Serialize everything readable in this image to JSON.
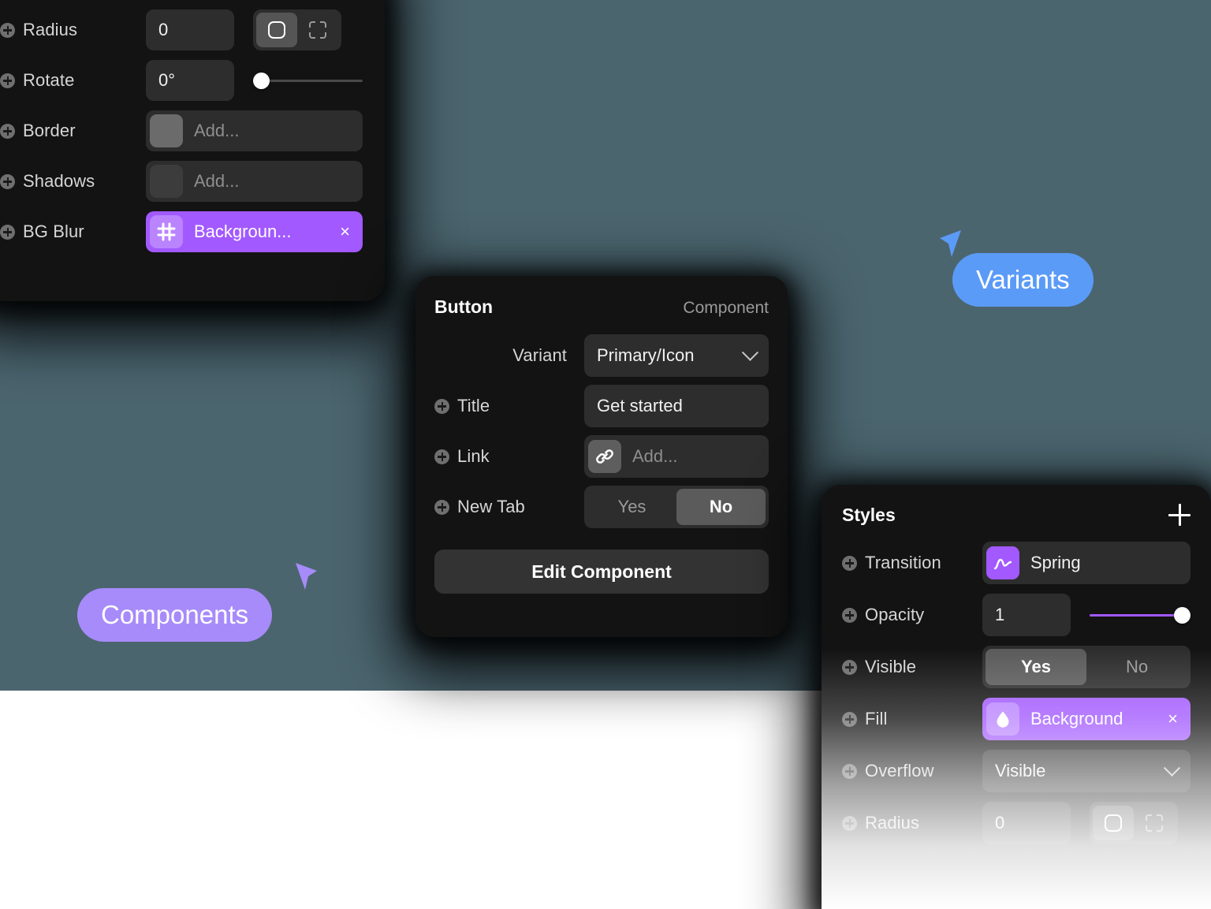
{
  "canvas": {
    "background_color": "#4b656f",
    "lower_band_color": "#ffffff"
  },
  "left_panel": {
    "rows": [
      {
        "label": "Radius",
        "type": "number-with-segmented",
        "value": "0",
        "segments": [
          {
            "icon": "rounded-square-icon",
            "selected": true
          },
          {
            "icon": "corner-brackets-icon",
            "selected": false
          }
        ]
      },
      {
        "label": "Rotate",
        "type": "number-with-slider",
        "value": "0°",
        "slider": {
          "percent": 0,
          "filled": false
        }
      },
      {
        "label": "Border",
        "type": "swatch-add",
        "placeholder": "Add...",
        "swatch_color": "#6b6b6b"
      },
      {
        "label": "Shadows",
        "type": "swatch-add",
        "placeholder": "Add...",
        "swatch_color": "#3c3c3c"
      },
      {
        "label": "BG Blur",
        "type": "chip",
        "chip_label": "Backgroun...",
        "chip_icon": "frame-hash-icon",
        "chip_color": "#a259ff",
        "removable": true,
        "remove_glyph": "×"
      }
    ]
  },
  "button_panel": {
    "title": "Button",
    "type_label": "Component",
    "rows": [
      {
        "label": "Variant",
        "has_plus": false,
        "control": "dropdown",
        "value": "Primary/Icon"
      },
      {
        "label": "Title",
        "has_plus": true,
        "control": "text",
        "value": "Get started"
      },
      {
        "label": "Link",
        "has_plus": true,
        "control": "icon-text",
        "icon": "link-chain-icon",
        "placeholder": "Add..."
      },
      {
        "label": "New Tab",
        "has_plus": true,
        "control": "toggle",
        "options": [
          "Yes",
          "No"
        ],
        "selected": "No"
      }
    ],
    "action_label": "Edit Component"
  },
  "styles_panel": {
    "title": "Styles",
    "add_icon": "plus-icon",
    "rows": [
      {
        "label": "Transition",
        "control": "icon-text",
        "icon": "spring-curve-icon",
        "value": "Spring",
        "icon_color": "#a259ff"
      },
      {
        "label": "Opacity",
        "control": "number-with-slider",
        "value": "1",
        "slider": {
          "percent": 100,
          "filled": true,
          "color": "#a259ff"
        }
      },
      {
        "label": "Visible",
        "control": "toggle",
        "options": [
          "Yes",
          "No"
        ],
        "selected": "Yes"
      },
      {
        "label": "Fill",
        "control": "chip",
        "chip_label": "Background",
        "chip_icon": "droplet-icon",
        "chip_color": "#a259ff",
        "removable": true,
        "remove_glyph": "×"
      },
      {
        "label": "Overflow",
        "control": "dropdown",
        "value": "Visible"
      },
      {
        "label": "Radius",
        "control": "number-with-segmented",
        "value": "0",
        "segments": [
          {
            "icon": "rounded-square-icon",
            "selected": true
          },
          {
            "icon": "corner-brackets-icon",
            "selected": false
          }
        ]
      }
    ]
  },
  "annotations": [
    {
      "label": "Variants",
      "color": "#5b9bf8",
      "cursor": "cursor-arrow-icon"
    },
    {
      "label": "Components",
      "color": "#a78bfa",
      "cursor": "cursor-arrow-icon"
    }
  ]
}
